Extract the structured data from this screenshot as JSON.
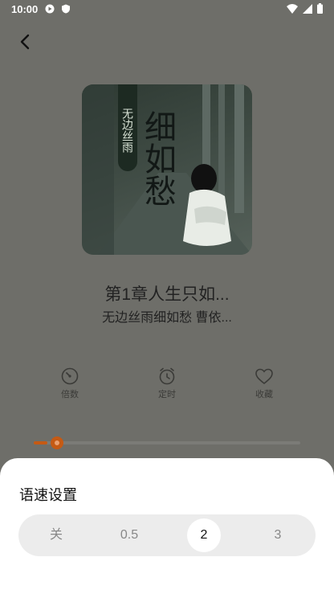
{
  "status": {
    "time": "10:00"
  },
  "book": {
    "cover_tag": "无边丝雨",
    "cover_calligraphy": "细如愁",
    "title": "第1章人生只如...",
    "subtitle": "无边丝雨细如愁 曹依..."
  },
  "controls": [
    {
      "label": "倍数",
      "icon": "speed-icon"
    },
    {
      "label": "定时",
      "icon": "alarm-clock-icon"
    },
    {
      "label": "收藏",
      "icon": "heart-icon"
    }
  ],
  "progress": {
    "fraction": 0.05
  },
  "speed_sheet": {
    "title": "语速设置",
    "options": [
      "关",
      "0.5",
      "2",
      "3"
    ],
    "selected": "2"
  },
  "colors": {
    "accent": "#c55a14",
    "dim_overlay": "#6e6e69"
  }
}
